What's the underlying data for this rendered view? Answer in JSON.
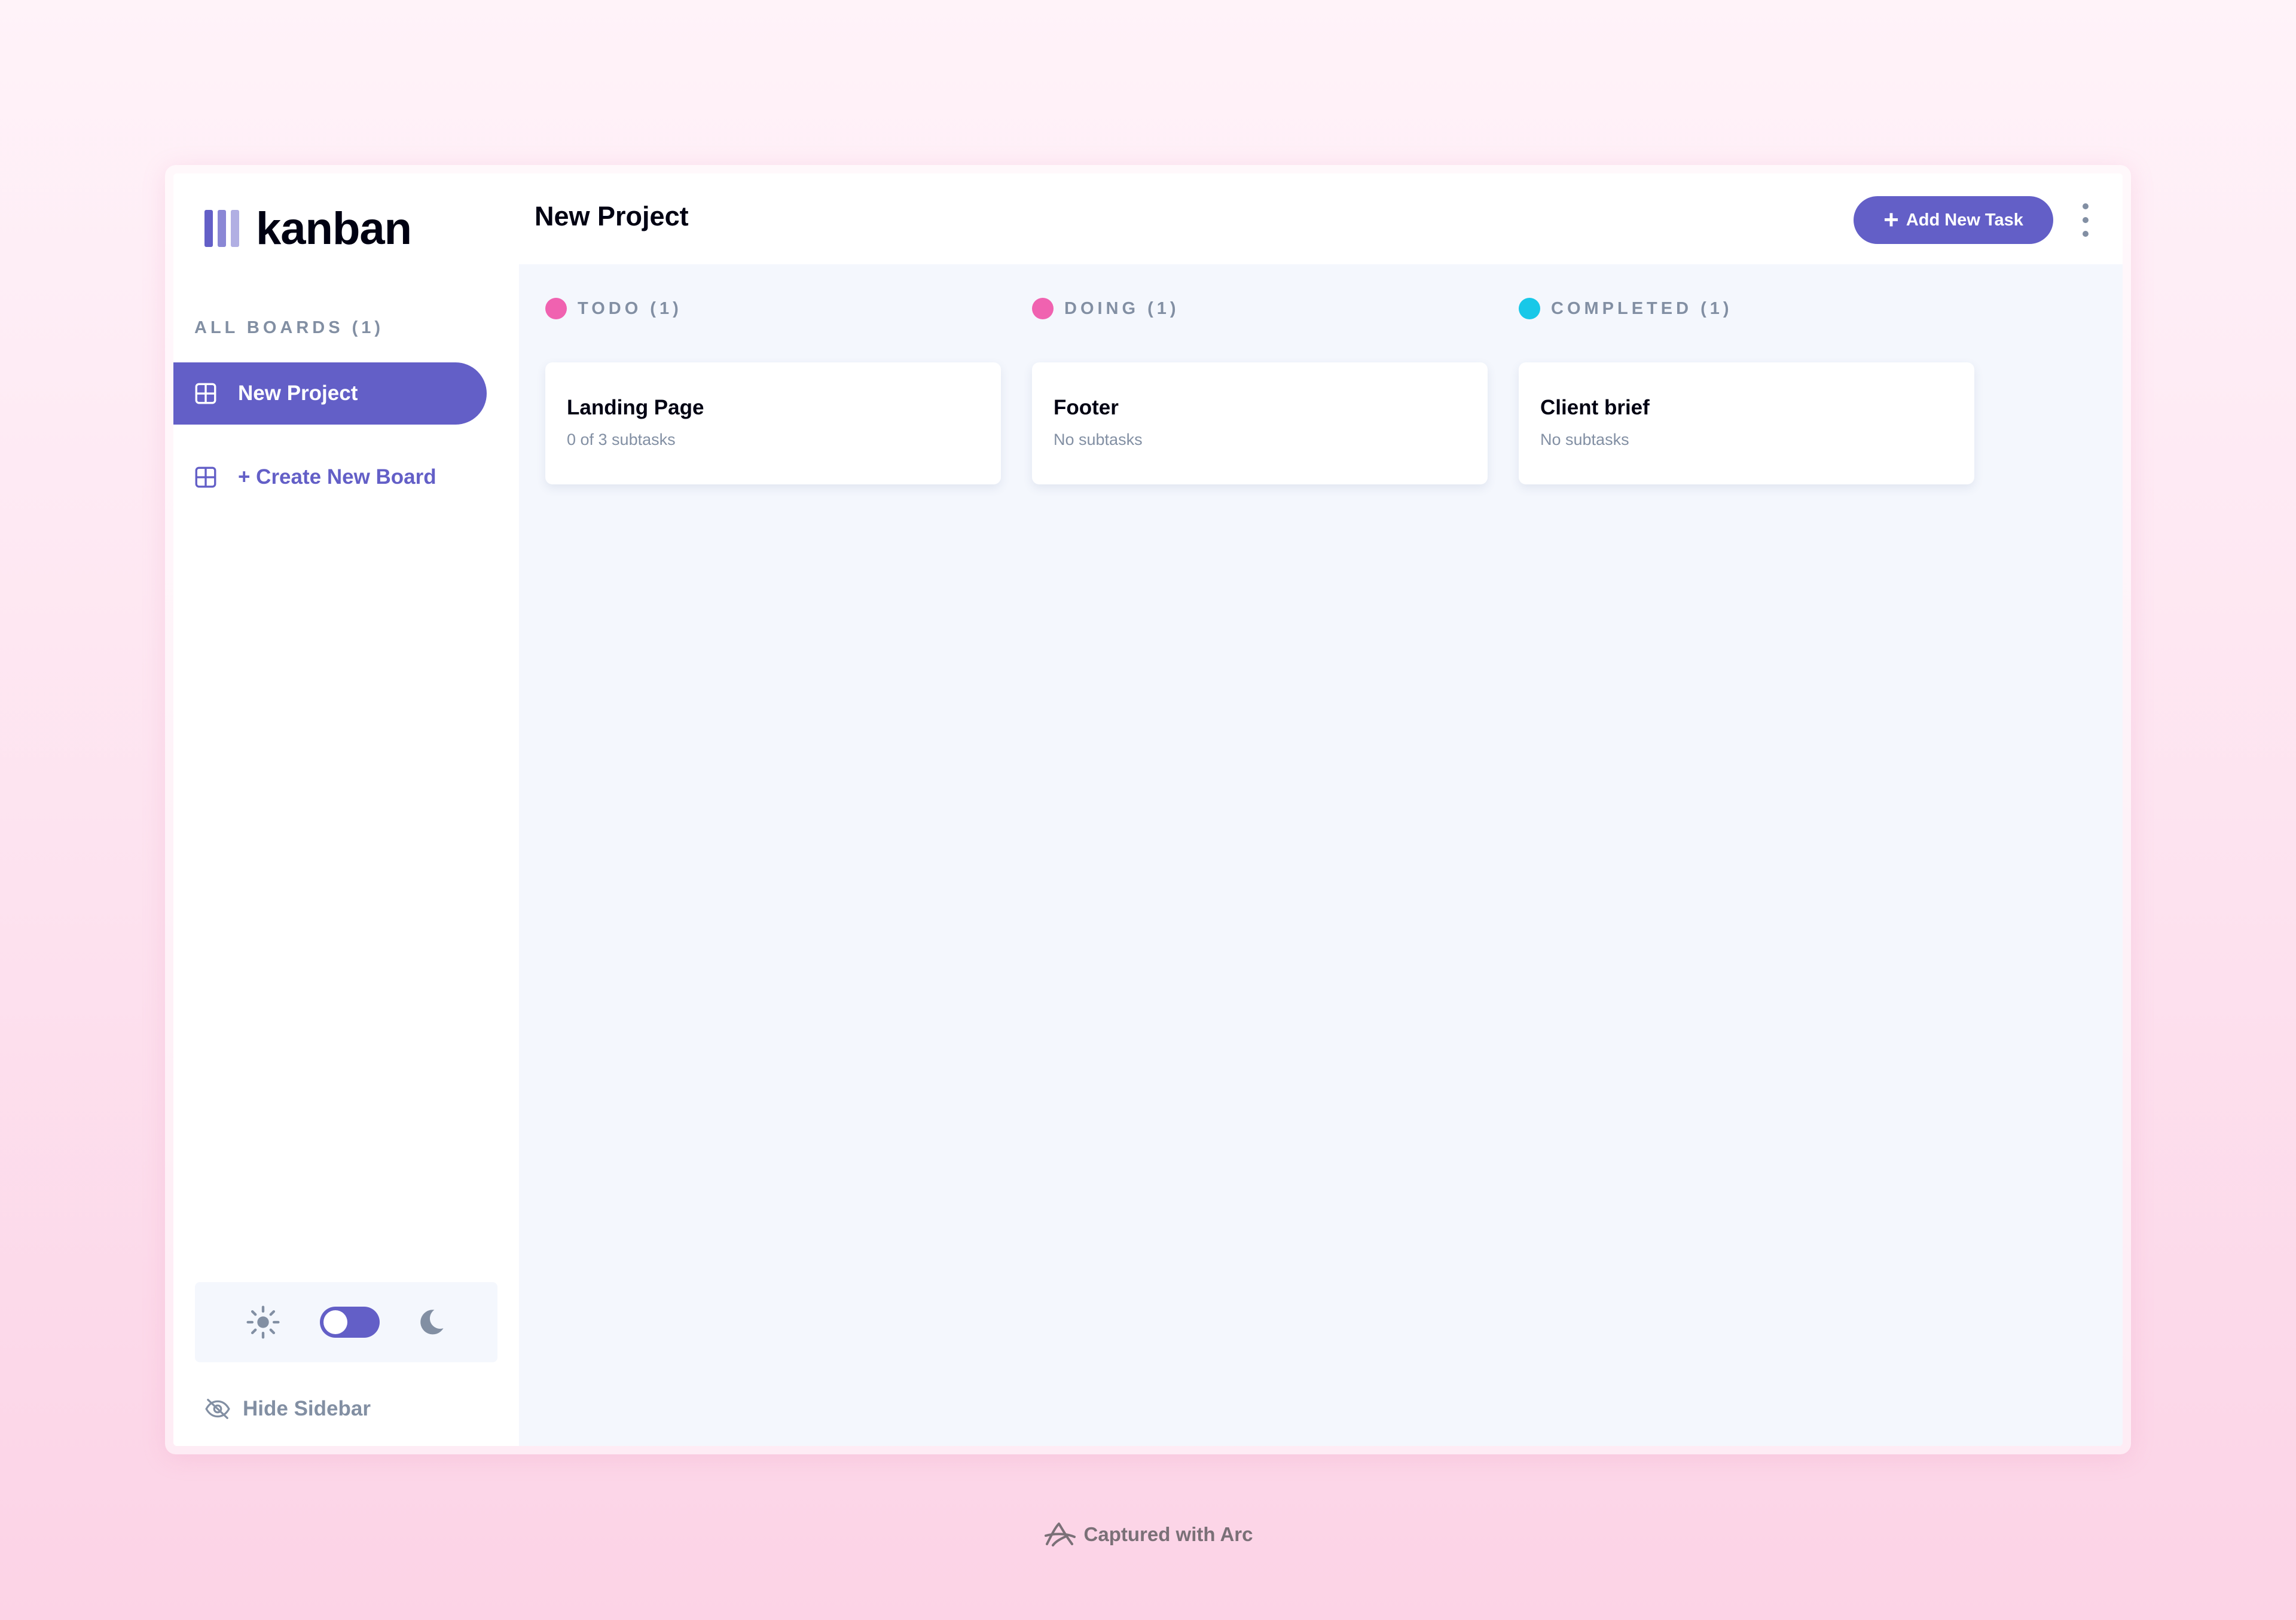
{
  "app": {
    "logo_text": "kanban"
  },
  "sidebar": {
    "boards_heading": "ALL BOARDS (1)",
    "boards": [
      {
        "label": "New Project",
        "active": true
      }
    ],
    "create_board_label": "+ Create New Board",
    "hide_sidebar_label": "Hide Sidebar",
    "theme": {
      "light_icon": "sun-icon",
      "dark_icon": "moon-icon",
      "mode": "light"
    }
  },
  "header": {
    "board_title": "New Project",
    "add_task_plus": "+",
    "add_task_label": "Add New Task",
    "menu_icon": "vertical-ellipsis-icon"
  },
  "columns": [
    {
      "label": "TODO (1)",
      "color": "#f062b0",
      "tasks": [
        {
          "title": "Landing Page",
          "subtasks": "0 of 3 subtasks"
        }
      ]
    },
    {
      "label": "DOING (1)",
      "color": "#f062b0",
      "tasks": [
        {
          "title": "Footer",
          "subtasks": "No subtasks"
        }
      ]
    },
    {
      "label": "COMPLETED (1)",
      "color": "#18c8e8",
      "tasks": [
        {
          "title": "Client brief",
          "subtasks": "No subtasks"
        }
      ]
    }
  ],
  "colors": {
    "accent": "#635fc7",
    "muted_text": "#828fa3",
    "board_bg": "#f4f7fd",
    "heading_text": "#000112"
  },
  "caption": {
    "text": "Captured with Arc",
    "icon": "arc-logo-icon"
  }
}
